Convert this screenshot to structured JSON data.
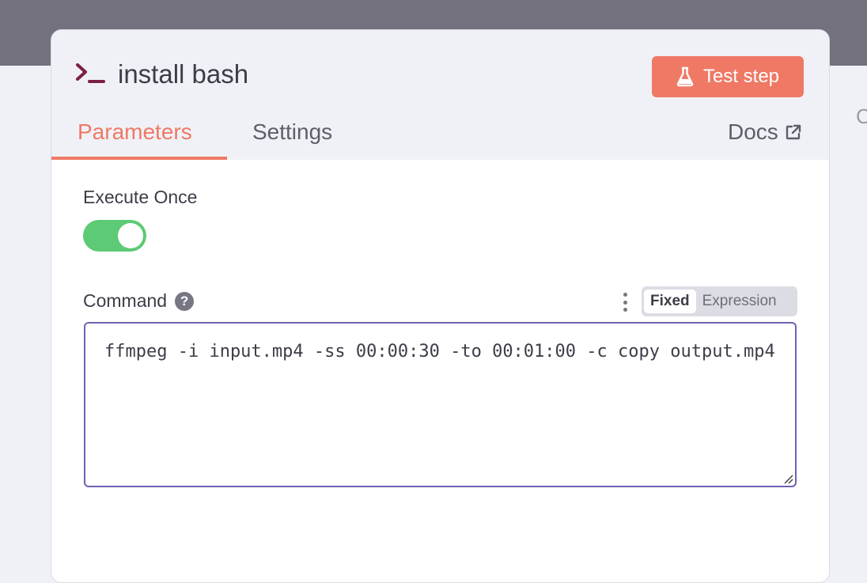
{
  "background": {
    "right_edge_text": "C"
  },
  "panel": {
    "title": "install bash",
    "title_icon": "terminal-icon",
    "test_button": {
      "label": "Test step",
      "icon": "flask-icon",
      "color": "#ef7965"
    },
    "tabs": [
      {
        "label": "Parameters",
        "active": true
      },
      {
        "label": "Settings",
        "active": false
      }
    ],
    "docs": {
      "label": "Docs",
      "icon": "external-link-icon"
    }
  },
  "parameters": {
    "execute_once": {
      "label": "Execute Once",
      "enabled": true,
      "color": "#5dca75"
    },
    "command": {
      "label": "Command",
      "help_icon": "question-circle-icon",
      "mode_options": [
        "Fixed",
        "Expression"
      ],
      "selected_mode": "Fixed",
      "value": "ffmpeg -i input.mp4 -ss 00:00:30 -to 00:01:00 -c copy output.mp4",
      "border_color": "#7160b4"
    }
  }
}
